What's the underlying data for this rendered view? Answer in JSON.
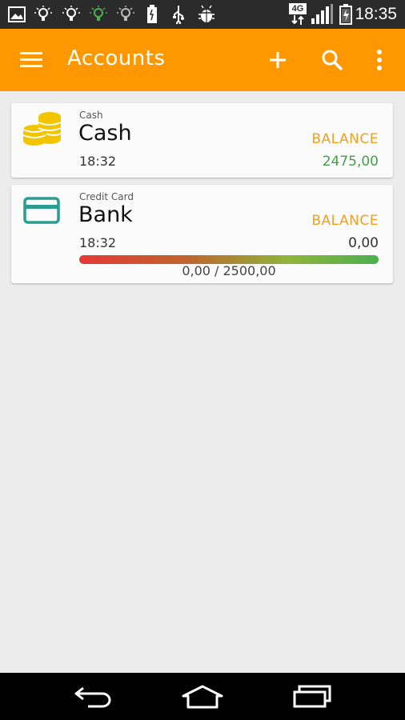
{
  "status": {
    "time": "18:35",
    "network": "4G"
  },
  "appbar": {
    "title": "Accounts"
  },
  "accounts": [
    {
      "type": "Cash",
      "name": "Cash",
      "time": "18:32",
      "balance_label": "BALANCE",
      "balance": "2475,00",
      "balance_color": "#43a047"
    },
    {
      "type": "Credit Card",
      "name": "Bank",
      "time": "18:32",
      "balance_label": "BALANCE",
      "balance": "0,00",
      "balance_color": "#333333",
      "credit_progress_text": "0,00 / 2500,00"
    }
  ],
  "colors": {
    "accent": "#ff9800",
    "cash_icon": "#f2c500",
    "card_icon": "#2a9d8f"
  },
  "icons": [
    "gallery-icon",
    "lightbulb-icon",
    "lightbulb-icon",
    "lightbulb-green-icon",
    "lightbulb-icon",
    "battery-icon",
    "usb-icon",
    "android-debug-icon",
    "signal-icon",
    "battery-charging-icon",
    "menu-icon",
    "add-icon",
    "search-icon",
    "more-vert-icon",
    "coins-icon",
    "credit-card-icon",
    "back-icon",
    "home-icon",
    "recents-icon"
  ]
}
